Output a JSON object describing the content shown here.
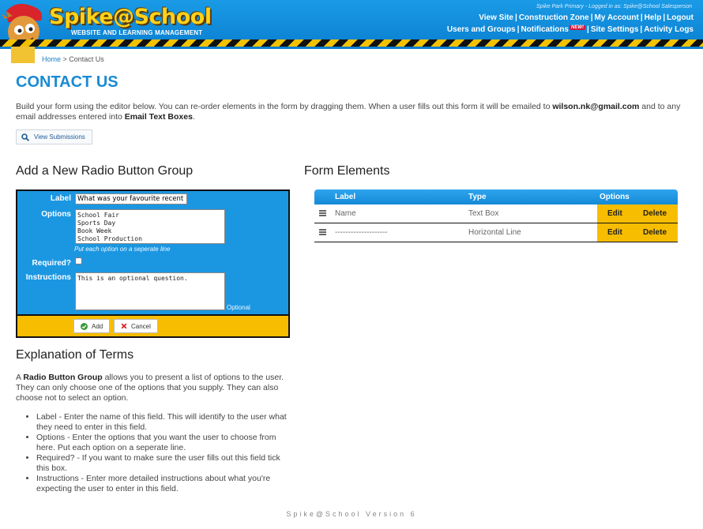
{
  "header": {
    "logo_text": "Spike@School",
    "logo_subtitle": "WEBSITE AND LEARNING MANAGEMENT",
    "logged_in": "Spike Park Primary - Logged in as: Spike@School Salesperson",
    "nav_row1": [
      "View Site",
      "Construction Zone",
      "My Account",
      "Help",
      "Logout"
    ],
    "nav_row2": [
      "Users and Groups",
      "Notifications",
      "Site Settings",
      "Activity Logs"
    ],
    "new_badge": "NEW!"
  },
  "breadcrumb": {
    "home": "Home",
    "sep": " > ",
    "current": "Contact Us"
  },
  "page_title": "CONTACT US",
  "intro": {
    "part1": "Build your form using the editor below. You can re-order elements in the form by dragging them. When a user fills out this form it will be emailed to ",
    "email": "wilson.nk@gmail.com",
    "part2": " and to any email addresses entered into ",
    "bold2": "Email Text Boxes",
    "part3": "."
  },
  "view_submissions": "View Submissions",
  "radio_section": {
    "title": "Add a New Radio Button Group",
    "label_label": "Label",
    "label_value": "What was your favourite recent school event?",
    "options_label": "Options",
    "options_value": "School Fair\nSports Day\nBook Week\nSchool Production",
    "options_hint": "Put each option on a seperate line",
    "required_label": "Required?",
    "instructions_label": "Instructions",
    "instructions_value": "This is an optional question.",
    "optional_hint": "Optional",
    "add_label": "Add",
    "cancel_label": "Cancel"
  },
  "form_elements": {
    "title": "Form Elements",
    "headers": {
      "label": "Label",
      "type": "Type",
      "options": "Options"
    },
    "rows": [
      {
        "label": "Name",
        "type": "Text Box",
        "edit": "Edit",
        "delete": "Delete"
      },
      {
        "label": "--------------------",
        "type": "Horizontal Line",
        "edit": "Edit",
        "delete": "Delete"
      }
    ]
  },
  "explanation": {
    "title": "Explanation of Terms",
    "p_prefix": "A ",
    "p_bold": "Radio Button Group",
    "p_rest": " allows you to present a list of options to the user. They can only choose one of the options that you supply. They can also choose not to select an option.",
    "items": [
      "Label - Enter the name of this field. This will identify to the user what they need to enter in this field.",
      "Options - Enter the options that you want the user to choose from here. Put each option on a seperate line.",
      "Required? - If you want to make sure the user fills out this field tick this box.",
      "Instructions - Enter more detailed instructions about what you're expecting the user to enter in this field."
    ]
  },
  "footer": "Spike@School Version 6",
  "colors": {
    "header_blue": "#0a7fd0",
    "title_blue": "#1a8ad4",
    "form_blue": "#1b97e2",
    "accent_yellow": "#f7bd00"
  },
  "icons": [
    "mascot-icon",
    "search-icon",
    "check-icon",
    "x-icon",
    "drag-handle-icon"
  ]
}
